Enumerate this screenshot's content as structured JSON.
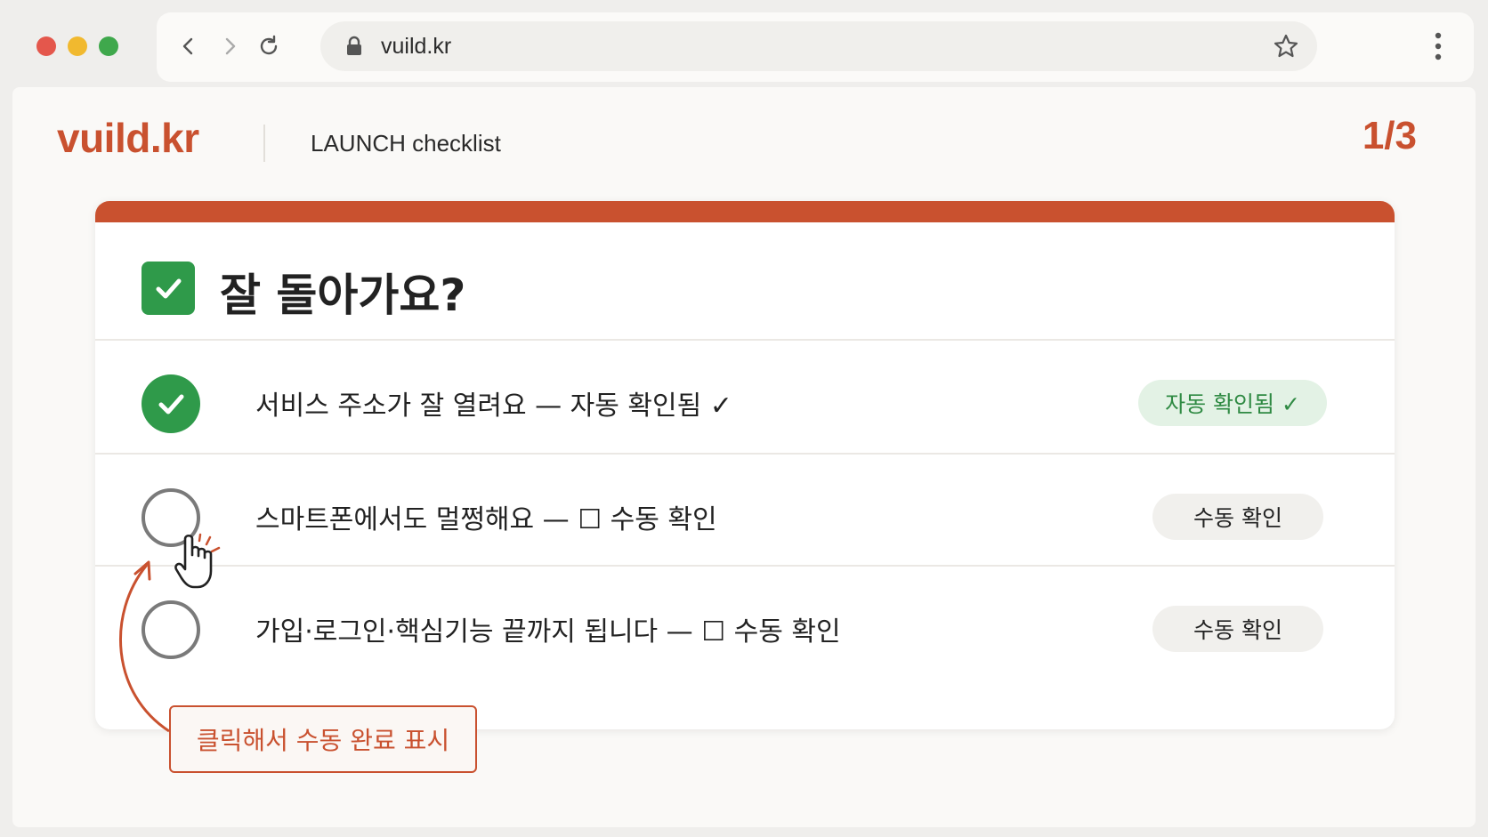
{
  "browser": {
    "url": "vuild.kr",
    "icons": [
      "back-icon",
      "forward-icon",
      "reload-icon",
      "lock-icon",
      "star-icon",
      "more-vertical-icon"
    ]
  },
  "header": {
    "logo": "vuild.kr",
    "subtitle": "LAUNCH checklist",
    "step": "1/3"
  },
  "card": {
    "title": "잘 돌아가요?",
    "accent": "#c9512f",
    "items": [
      {
        "text": "서비스 주소가 잘 열려요 — 자동 확인됨 ✓",
        "status": "자동 확인됨 ✓",
        "done": true
      },
      {
        "text": "스마트폰에서도 멀쩡해요 — ☐ 수동 확인",
        "status": "수동 확인",
        "done": false
      },
      {
        "text": "가입·로그인·핵심기능 끝까지 됩니다 — ☐ 수동 확인",
        "status": "수동 확인",
        "done": false
      }
    ]
  },
  "annotation": {
    "text": "클릭해서 수동 완료 표시"
  },
  "colors": {
    "brand": "#c9512f",
    "success": "#2f9a4a"
  }
}
